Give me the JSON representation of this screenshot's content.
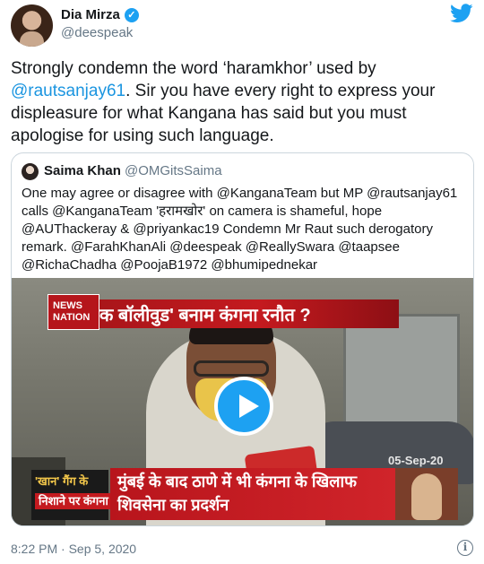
{
  "author": {
    "display_name": "Dia Mirza",
    "handle": "@deespeak",
    "verified_icon": "verified-badge-icon"
  },
  "tweet": {
    "text_parts": [
      "Strongly condemn the word ‘haramkhor’ used by ",
      "@rautsanjay61",
      ". Sir you have every right to express your displeasure for what Kangana has said but you must apologise for using such language."
    ],
    "timestamp": "8:22 PM · Sep 5, 2020"
  },
  "quoted_tweet": {
    "display_name": "Saima Khan",
    "handle": "@OMGitsSaima",
    "text": "One may agree or disagree with @KanganaTeam but MP @rautsanjay61 calls @KanganaTeam 'हरामखोर' on camera is shameful, hope @AUThackeray & @priyankac19 Condemn  Mr Raut such derogatory remark. @FarahKhanAli @deespeak @ReallySwara @taapsee @RichaChadha @PoojaB1972 @bhumipednekar"
  },
  "video": {
    "logo_text": "NEWS NATION",
    "top_banner": "क बॉलीवुड' बनाम कंगना रनौत ?",
    "side_tag_line1": "'खान' गैंग के",
    "side_tag_line2": "निशाने पर कंगना",
    "bottom_banner": "मुंबई के बाद ठाणे में भी कंगना के खिलाफ शिवसेना का प्रदर्शन",
    "date_overlay": "05-Sep-20"
  },
  "colors": {
    "link": "#1b95e0",
    "twitter_blue": "#1da1f2",
    "secondary_text": "#657786"
  }
}
